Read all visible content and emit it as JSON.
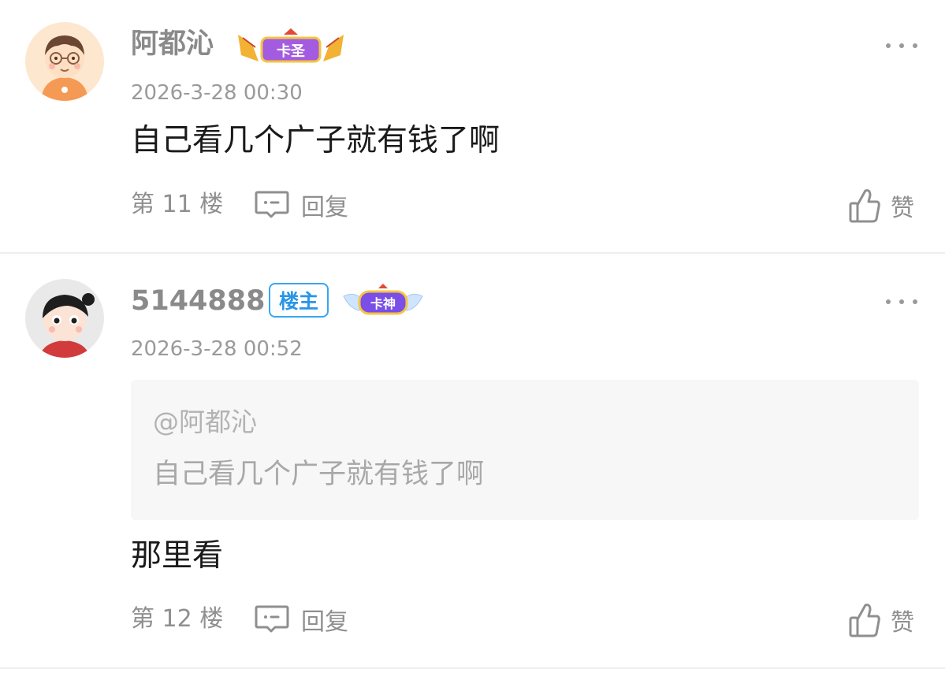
{
  "posts": [
    {
      "username": "阿都沁",
      "level_badge": "卡圣",
      "timestamp": "2026-3-28 00:30",
      "content": "自己看几个广子就有钱了啊",
      "floor": "第 11 楼",
      "reply_label": "回复",
      "like_label": "赞",
      "avatar_icon": "cartoon-boy-glasses-avatar",
      "badge_color": "#a35ce0"
    },
    {
      "username": "5144888",
      "owner_badge": "楼主",
      "level_badge": "卡神",
      "timestamp": "2026-3-28 00:52",
      "quote": {
        "user": "@阿都沁",
        "text": "自己看几个广子就有钱了啊"
      },
      "content": "那里看",
      "floor": "第 12 楼",
      "reply_label": "回复",
      "like_label": "赞",
      "avatar_icon": "cartoon-girl-avatar",
      "badge_color": "#7b4ee8"
    }
  ]
}
